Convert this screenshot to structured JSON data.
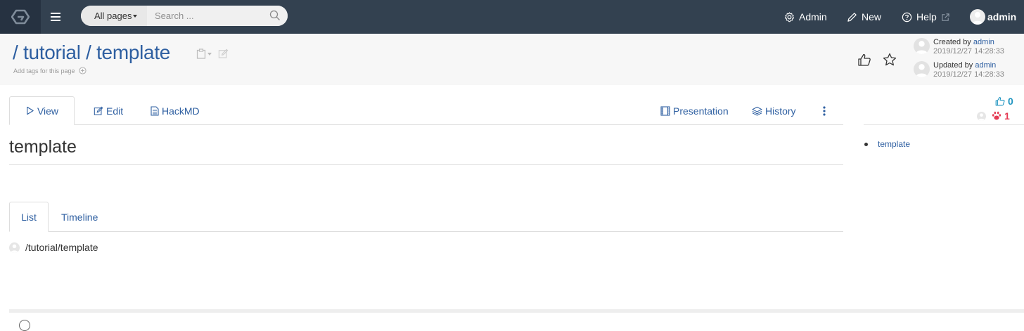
{
  "navbar": {
    "scope_label": "All pages",
    "search_placeholder": "Search ...",
    "admin_label": "Admin",
    "new_label": "New",
    "help_label": "Help",
    "user_name": "admin"
  },
  "header": {
    "path_sep1": "/",
    "path_part1": "tutorial",
    "path_sep2": "/",
    "path_part2": "template",
    "tags_hint": "Add tags for this page",
    "created_label": "Created by",
    "created_by": "admin",
    "created_at": "2019/12/27 14:28:33",
    "updated_label": "Updated by",
    "updated_by": "admin",
    "updated_at": "2019/12/27 14:28:33"
  },
  "tabs": {
    "view": "View",
    "edit": "Edit",
    "hackmd": "HackMD",
    "presentation": "Presentation",
    "history": "History"
  },
  "content": {
    "title": "template"
  },
  "sub_tabs": {
    "list": "List",
    "timeline": "Timeline"
  },
  "page_list": [
    {
      "path": "/tutorial/template"
    }
  ],
  "sidebar": {
    "likes_count": "0",
    "bookmarks_count": "1",
    "toc_items": [
      "template"
    ]
  },
  "colors": {
    "navbar_bg": "#334150",
    "link": "#2e5fa1",
    "like": "#1e94c0",
    "bookmark": "#e53b54"
  }
}
